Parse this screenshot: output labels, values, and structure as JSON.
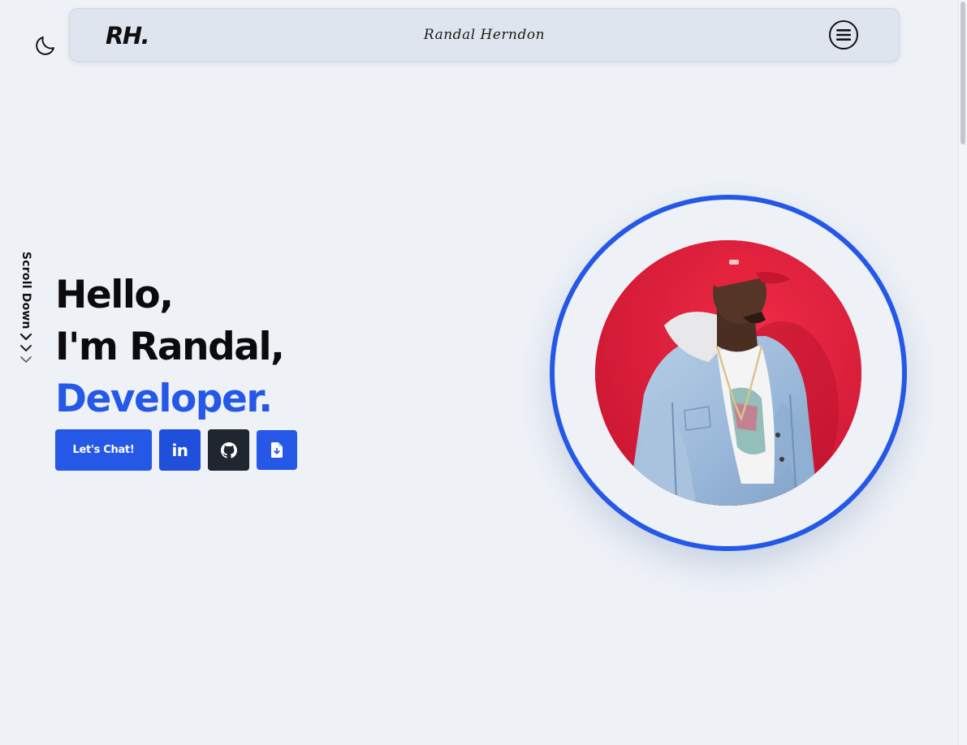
{
  "header": {
    "logo": "RH.",
    "signature": "Randal Herndon"
  },
  "icons": {
    "theme": "moon-icon",
    "menu": "menu-icon",
    "linkedin": "linkedin-icon",
    "github": "github-icon",
    "resume": "file-download-icon"
  },
  "side": {
    "scroll_label": "Scroll Down"
  },
  "hero": {
    "line1": "Hello,",
    "line2": "I'm Randal,",
    "line3": "Developer."
  },
  "actions": {
    "chat_label": "Let's Chat!",
    "linkedin_label": "in"
  },
  "colors": {
    "accent": "#2558e6",
    "background": "#eef2f7",
    "portrait_bg": "#d81b33"
  }
}
